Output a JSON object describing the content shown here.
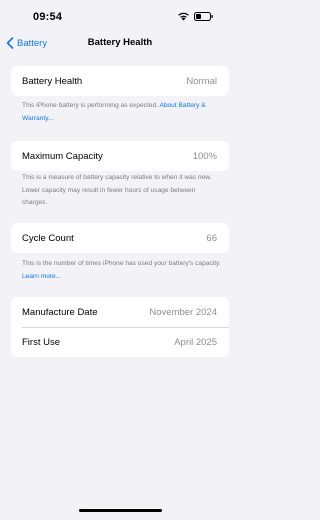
{
  "status_bar": {
    "time": "09:54",
    "wifi_icon": "wifi-icon",
    "battery_icon": "battery-icon"
  },
  "nav": {
    "back_label": "Battery",
    "title": "Battery Health",
    "back_icon": "chevron-left-icon"
  },
  "battery_health": {
    "label": "Battery Health",
    "value": "Normal",
    "note": "This iPhone battery is performing as expected.",
    "link": "About Battery & Warranty..."
  },
  "maximum_capacity": {
    "label": "Maximum Capacity",
    "value": "100%",
    "note": "This is a measure of battery capacity relative to when it was new. Lower capacity may result in fewer hours of usage between charges."
  },
  "cycle_count": {
    "label": "Cycle Count",
    "value": "66",
    "note": "This is the number of times iPhone has used your battery's capacity.",
    "link": "Learn more..."
  },
  "dates": {
    "manufacture_label": "Manufacture Date",
    "manufacture_value": "November 2024",
    "first_use_label": "First Use",
    "first_use_value": "April 2025"
  },
  "colors": {
    "accent": "#0a7aff",
    "background": "#f2f2f7",
    "secondary_text": "#8e8e93"
  }
}
